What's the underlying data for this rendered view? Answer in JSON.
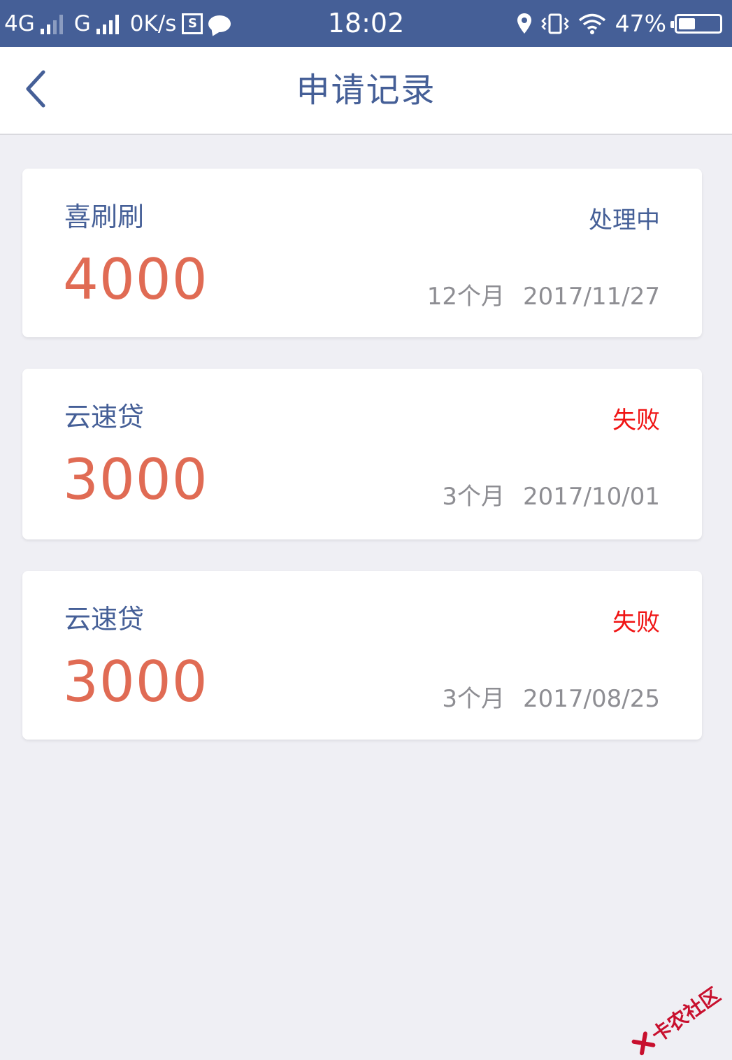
{
  "status_bar": {
    "network1": "4G",
    "network2": "G",
    "speed": "0K/s",
    "time": "18:02",
    "battery": "47%"
  },
  "nav": {
    "title": "申请记录"
  },
  "records": [
    {
      "product": "喜刷刷",
      "status": "处理中",
      "status_type": "processing",
      "amount": "4000",
      "term": "12个月",
      "date": "2017/11/27"
    },
    {
      "product": "云速贷",
      "status": "失败",
      "status_type": "failed",
      "amount": "3000",
      "term": "3个月",
      "date": "2017/10/01"
    },
    {
      "product": "云速贷",
      "status": "失败",
      "status_type": "failed",
      "amount": "3000",
      "term": "3个月",
      "date": "2017/08/25"
    }
  ],
  "watermark": "卡农社区",
  "colors": {
    "primary": "#455f97",
    "amount": "#e06b54",
    "failed": "#f01414",
    "meta": "#8e8e93",
    "background": "#efeff4"
  }
}
